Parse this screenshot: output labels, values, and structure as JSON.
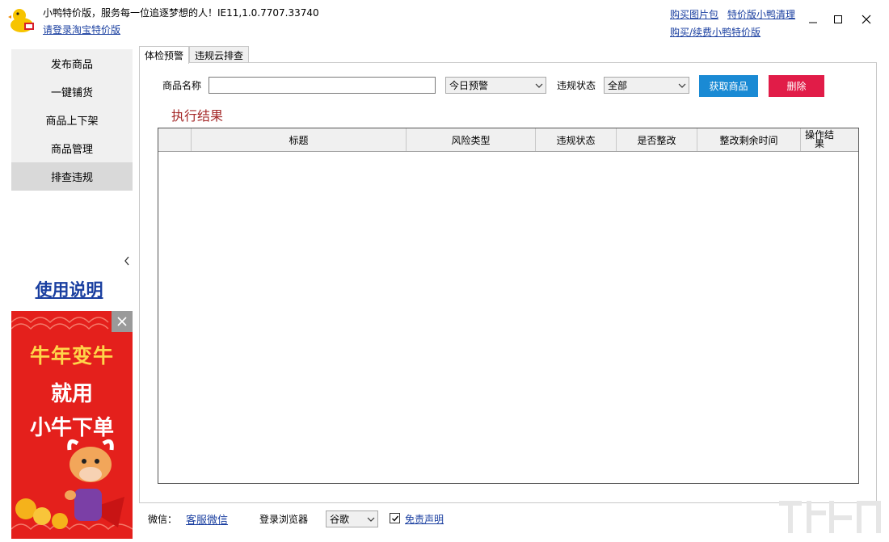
{
  "header": {
    "app_title": "小鸭特价版，服务每一位追逐梦想的人！IE11,1.0.7707.33740",
    "login_link": "请登录淘宝特价版",
    "links": [
      "购买图片包",
      "特价版小鸭清理",
      "购买/续费小鸭特价版"
    ],
    "window_controls": [
      "minimize-icon",
      "maximize-icon",
      "close-icon"
    ]
  },
  "sidebar": {
    "items": [
      {
        "label": "发布商品"
      },
      {
        "label": "一键铺货"
      },
      {
        "label": "商品上下架"
      },
      {
        "label": "商品管理"
      },
      {
        "label": "排查违规"
      }
    ],
    "active_index": 4,
    "manual_link": "使用说明"
  },
  "ad": {
    "line1": "牛年变牛",
    "line2": "就用",
    "line3": "小牛下单"
  },
  "tabs": [
    {
      "label": "体检预警"
    },
    {
      "label": "违规云排查"
    }
  ],
  "form": {
    "name_label": "商品名称",
    "name_value": "",
    "warning_select": "今日预警",
    "status_label": "违规状态",
    "status_select": "全部",
    "fetch_button": "获取商品",
    "delete_button": "删除",
    "result_title": "执行结果"
  },
  "grid": {
    "columns": [
      "",
      "标题",
      "风险类型",
      "违规状态",
      "是否整改",
      "整改剩余时间",
      "操作结果"
    ],
    "rows": []
  },
  "footer": {
    "wechat_label": "微信：",
    "service_link": "客服微信",
    "browser_label": "登录浏览器",
    "browser_select": "谷歌",
    "disclaimer_checked": true,
    "disclaimer_link": "免责声明"
  },
  "colors": {
    "link": "#1a3fa0",
    "fetch_button": "#1a8ad4",
    "delete_button": "#e11c48",
    "result_title": "#a52a2a",
    "ad_background": "#e4201c",
    "sidebar_active": "#d9d9d9"
  }
}
